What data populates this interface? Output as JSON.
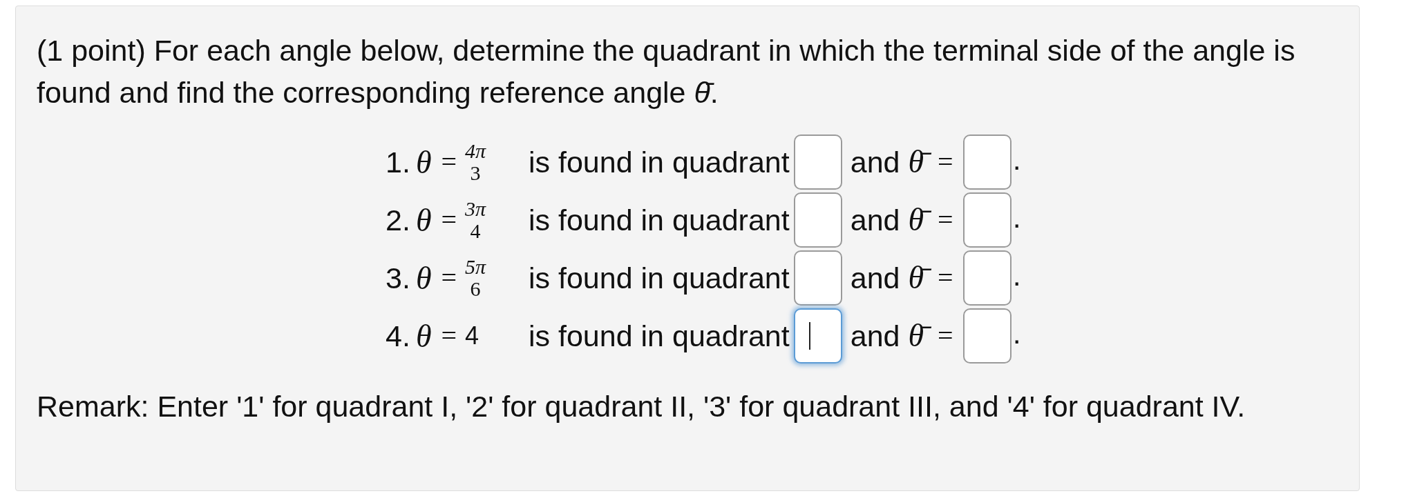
{
  "prompt": "(1 point) For each angle below, determine the quadrant in which the terminal side of the angle is found and find the corresponding reference angle *θ̄*.",
  "rows": [
    {
      "number": "1.",
      "variable": "θ",
      "equals": "=",
      "kind": "fraction",
      "numerator": "4π",
      "denominator": "3",
      "text": "is found in quadrant",
      "quadrant_field": {
        "focused": false
      },
      "conjunction": "and",
      "ref_symbol": "θ̄",
      "ref_equals": "=",
      "reference_field": {
        "focused": false
      },
      "end": "."
    },
    {
      "number": "2.",
      "variable": "θ",
      "equals": "=",
      "kind": "fraction",
      "numerator": "3π",
      "denominator": "4",
      "text": "is found in quadrant",
      "quadrant_field": {
        "focused": false
      },
      "conjunction": "and",
      "ref_symbol": "θ̄",
      "ref_equals": "=",
      "reference_field": {
        "focused": false
      },
      "end": "."
    },
    {
      "number": "3.",
      "variable": "θ",
      "equals": "=",
      "kind": "fraction",
      "numerator": "5π",
      "denominator": "6",
      "text": "is found in quadrant",
      "quadrant_field": {
        "focused": false
      },
      "conjunction": "and",
      "ref_symbol": "θ̄",
      "ref_equals": "=",
      "reference_field": {
        "focused": false
      },
      "end": "."
    },
    {
      "number": "4.",
      "variable": "θ",
      "equals": "=",
      "kind": "plain",
      "value": "4",
      "text": "is found in quadrant",
      "quadrant_field": {
        "focused": true
      },
      "conjunction": "and",
      "ref_symbol": "θ̄",
      "ref_equals": "=",
      "reference_field": {
        "focused": false
      },
      "end": "."
    }
  ],
  "remark": "Remark: Enter '1' for quadrant I, '2' for quadrant II, '3' for quadrant III, and '4' for quadrant IV."
}
